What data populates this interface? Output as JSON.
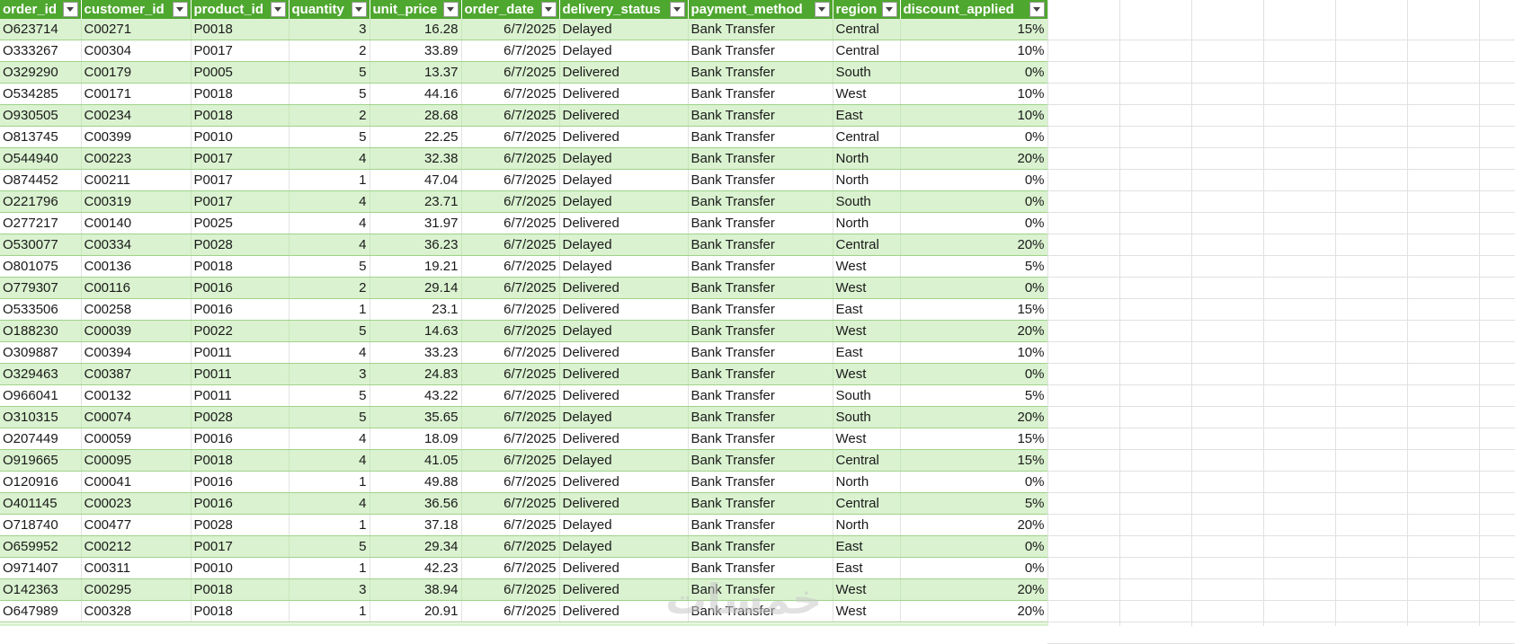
{
  "columns": [
    "order_id",
    "customer_id",
    "product_id",
    "quantity",
    "unit_price",
    "order_date",
    "delivery_status",
    "payment_method",
    "region",
    "discount_applied"
  ],
  "rows": [
    [
      "O623714",
      "C00271",
      "P0018",
      "3",
      "16.28",
      "6/7/2025",
      "Delayed",
      "Bank Transfer",
      "Central",
      "15%"
    ],
    [
      "O333267",
      "C00304",
      "P0017",
      "2",
      "33.89",
      "6/7/2025",
      "Delayed",
      "Bank Transfer",
      "Central",
      "10%"
    ],
    [
      "O329290",
      "C00179",
      "P0005",
      "5",
      "13.37",
      "6/7/2025",
      "Delivered",
      "Bank Transfer",
      "South",
      "0%"
    ],
    [
      "O534285",
      "C00171",
      "P0018",
      "5",
      "44.16",
      "6/7/2025",
      "Delivered",
      "Bank Transfer",
      "West",
      "10%"
    ],
    [
      "O930505",
      "C00234",
      "P0018",
      "2",
      "28.68",
      "6/7/2025",
      "Delivered",
      "Bank Transfer",
      "East",
      "10%"
    ],
    [
      "O813745",
      "C00399",
      "P0010",
      "5",
      "22.25",
      "6/7/2025",
      "Delivered",
      "Bank Transfer",
      "Central",
      "0%"
    ],
    [
      "O544940",
      "C00223",
      "P0017",
      "4",
      "32.38",
      "6/7/2025",
      "Delayed",
      "Bank Transfer",
      "North",
      "20%"
    ],
    [
      "O874452",
      "C00211",
      "P0017",
      "1",
      "47.04",
      "6/7/2025",
      "Delayed",
      "Bank Transfer",
      "North",
      "0%"
    ],
    [
      "O221796",
      "C00319",
      "P0017",
      "4",
      "23.71",
      "6/7/2025",
      "Delayed",
      "Bank Transfer",
      "South",
      "0%"
    ],
    [
      "O277217",
      "C00140",
      "P0025",
      "4",
      "31.97",
      "6/7/2025",
      "Delivered",
      "Bank Transfer",
      "North",
      "0%"
    ],
    [
      "O530077",
      "C00334",
      "P0028",
      "4",
      "36.23",
      "6/7/2025",
      "Delayed",
      "Bank Transfer",
      "Central",
      "20%"
    ],
    [
      "O801075",
      "C00136",
      "P0018",
      "5",
      "19.21",
      "6/7/2025",
      "Delayed",
      "Bank Transfer",
      "West",
      "5%"
    ],
    [
      "O779307",
      "C00116",
      "P0016",
      "2",
      "29.14",
      "6/7/2025",
      "Delivered",
      "Bank Transfer",
      "West",
      "0%"
    ],
    [
      "O533506",
      "C00258",
      "P0016",
      "1",
      "23.1",
      "6/7/2025",
      "Delivered",
      "Bank Transfer",
      "East",
      "15%"
    ],
    [
      "O188230",
      "C00039",
      "P0022",
      "5",
      "14.63",
      "6/7/2025",
      "Delayed",
      "Bank Transfer",
      "West",
      "20%"
    ],
    [
      "O309887",
      "C00394",
      "P0011",
      "4",
      "33.23",
      "6/7/2025",
      "Delivered",
      "Bank Transfer",
      "East",
      "10%"
    ],
    [
      "O329463",
      "C00387",
      "P0011",
      "3",
      "24.83",
      "6/7/2025",
      "Delivered",
      "Bank Transfer",
      "West",
      "0%"
    ],
    [
      "O966041",
      "C00132",
      "P0011",
      "5",
      "43.22",
      "6/7/2025",
      "Delivered",
      "Bank Transfer",
      "South",
      "5%"
    ],
    [
      "O310315",
      "C00074",
      "P0028",
      "5",
      "35.65",
      "6/7/2025",
      "Delayed",
      "Bank Transfer",
      "South",
      "20%"
    ],
    [
      "O207449",
      "C00059",
      "P0016",
      "4",
      "18.09",
      "6/7/2025",
      "Delivered",
      "Bank Transfer",
      "West",
      "15%"
    ],
    [
      "O919665",
      "C00095",
      "P0018",
      "4",
      "41.05",
      "6/7/2025",
      "Delayed",
      "Bank Transfer",
      "Central",
      "15%"
    ],
    [
      "O120916",
      "C00041",
      "P0016",
      "1",
      "49.88",
      "6/7/2025",
      "Delivered",
      "Bank Transfer",
      "North",
      "0%"
    ],
    [
      "O401145",
      "C00023",
      "P0016",
      "4",
      "36.56",
      "6/7/2025",
      "Delivered",
      "Bank Transfer",
      "Central",
      "5%"
    ],
    [
      "O718740",
      "C00477",
      "P0028",
      "1",
      "37.18",
      "6/7/2025",
      "Delayed",
      "Bank Transfer",
      "North",
      "20%"
    ],
    [
      "O659952",
      "C00212",
      "P0017",
      "5",
      "29.34",
      "6/7/2025",
      "Delayed",
      "Bank Transfer",
      "East",
      "0%"
    ],
    [
      "O971407",
      "C00311",
      "P0010",
      "1",
      "42.23",
      "6/7/2025",
      "Delivered",
      "Bank Transfer",
      "East",
      "0%"
    ],
    [
      "O142363",
      "C00295",
      "P0018",
      "3",
      "38.94",
      "6/7/2025",
      "Delivered",
      "Bank Transfer",
      "West",
      "20%"
    ],
    [
      "O647989",
      "C00328",
      "P0018",
      "1",
      "20.91",
      "6/7/2025",
      "Delivered",
      "Bank Transfer",
      "West",
      "20%"
    ]
  ],
  "watermark": "خمسات",
  "colors": {
    "header_bg": "#4ea72e",
    "band_bg": "#daf2d0",
    "row_line": "#9fd38a"
  },
  "icons": {
    "filter": "filter-dropdown-icon"
  }
}
